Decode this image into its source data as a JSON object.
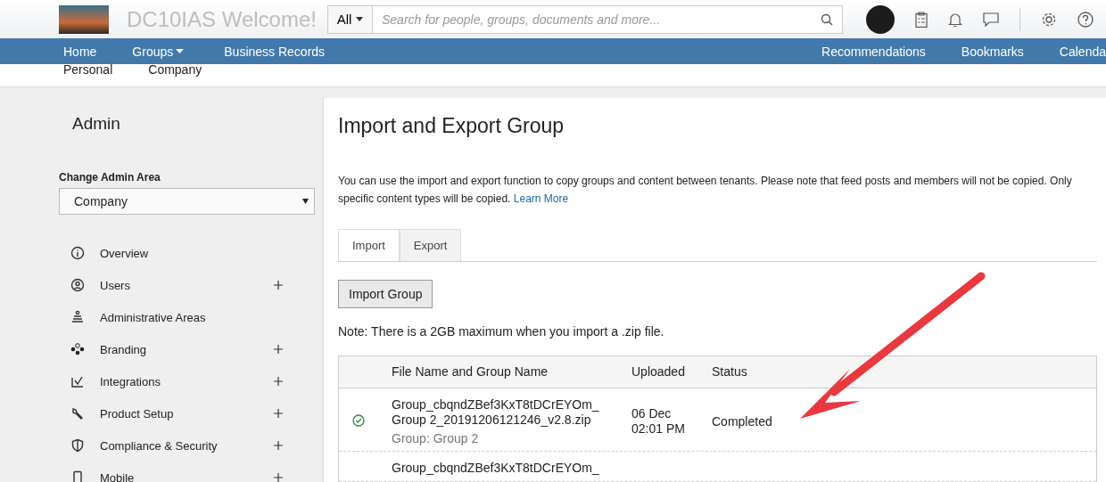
{
  "header": {
    "title": "DC10IAS Welcome!",
    "search": {
      "scope": "All",
      "placeholder": "Search for people, groups, documents and more..."
    }
  },
  "nav": {
    "items": [
      {
        "label": "Home",
        "dropdown": false
      },
      {
        "label": "Groups",
        "dropdown": true
      },
      {
        "label": "Business Records",
        "dropdown": false
      }
    ],
    "right_items": [
      "Recommendations",
      "Bookmarks",
      "Calenda"
    ]
  },
  "subnav": [
    "Personal",
    "Company"
  ],
  "sidebar": {
    "title": "Admin",
    "area_label": "Change Admin Area",
    "area_value": "Company",
    "items": [
      {
        "label": "Overview",
        "kind": "info",
        "expandable": false
      },
      {
        "label": "Users",
        "kind": "user",
        "expandable": true
      },
      {
        "label": "Administrative Areas",
        "kind": "areas",
        "expandable": false
      },
      {
        "label": "Branding",
        "kind": "branding",
        "expandable": true
      },
      {
        "label": "Integrations",
        "kind": "integrations",
        "expandable": true
      },
      {
        "label": "Product Setup",
        "kind": "wrench",
        "expandable": true
      },
      {
        "label": "Compliance & Security",
        "kind": "shield",
        "expandable": true
      },
      {
        "label": "Mobile",
        "kind": "mobile",
        "expandable": true
      }
    ]
  },
  "main": {
    "title": "Import and Export Group",
    "description": "You can use the import and export function to copy groups and content between tenants. Please note that feed posts and members will not be copied. Only specific content types will be copied.",
    "learn_more": "Learn More",
    "tabs": [
      {
        "label": "Import",
        "selected": true
      },
      {
        "label": "Export",
        "selected": false
      }
    ],
    "import_button": "Import Group",
    "note": "Note: There is a 2GB maximum when you import a .zip file.",
    "table": {
      "columns": [
        "File Name and Group Name",
        "Uploaded",
        "Status"
      ],
      "rows": [
        {
          "ok": true,
          "file_lines": [
            "Group_cbqndZBef3KxT8tDCrEYOm_",
            "Group 2_20191206121246_v2.8.zip"
          ],
          "group": "Group: Group 2",
          "uploaded_date": "06 Dec",
          "uploaded_time": "02:01 PM",
          "status": "Completed"
        },
        {
          "file_lines": [
            "Group_cbqndZBef3KxT8tDCrEYOm_"
          ]
        }
      ]
    }
  }
}
